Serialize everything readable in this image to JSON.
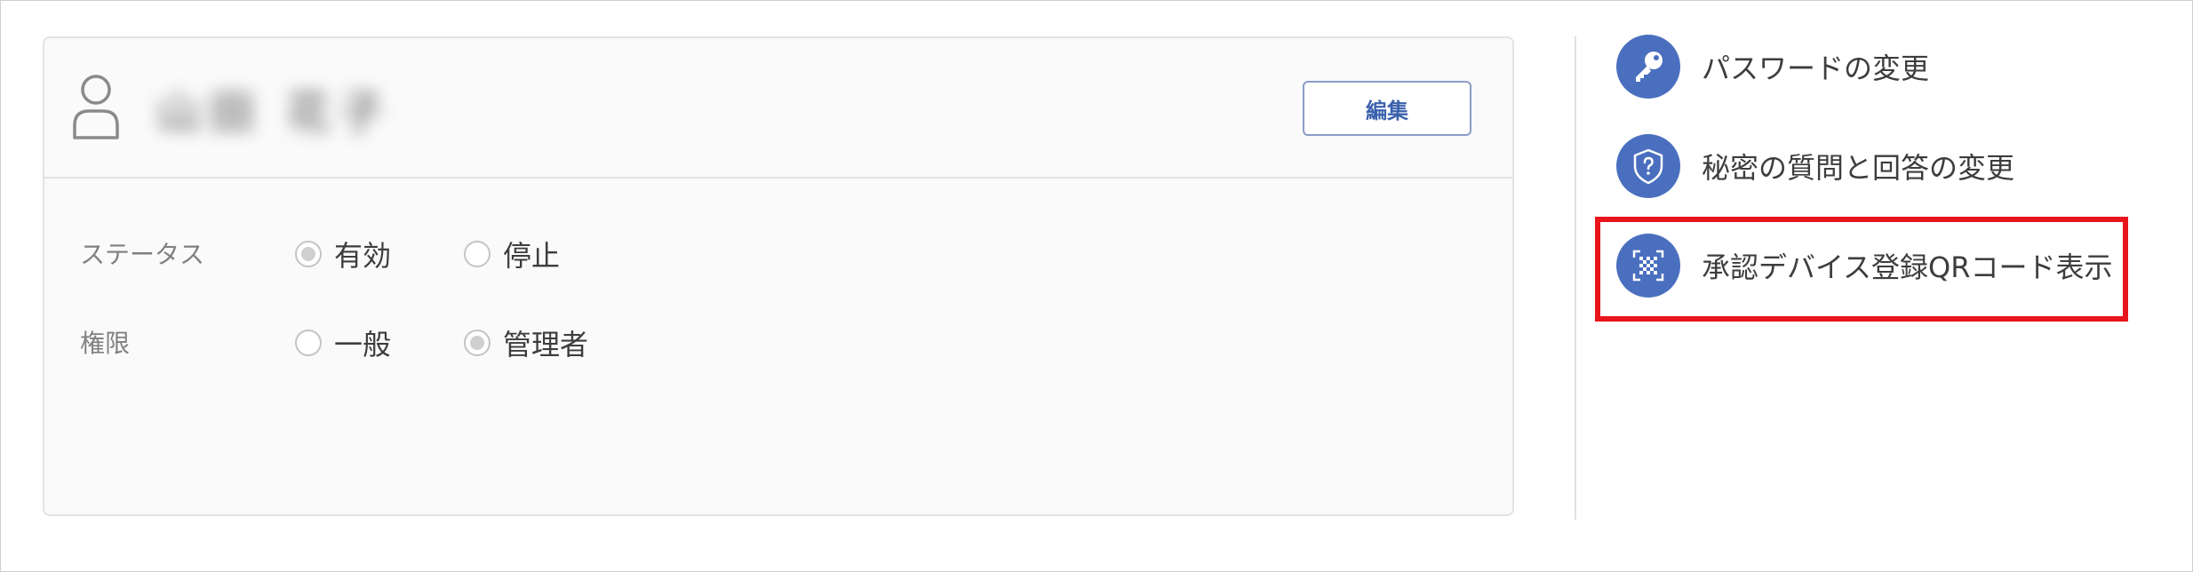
{
  "user": {
    "name": "山田 花子",
    "edit_label": "編集"
  },
  "status": {
    "label": "ステータス",
    "options": [
      {
        "label": "有効",
        "checked": true
      },
      {
        "label": "停止",
        "checked": false
      }
    ]
  },
  "permission": {
    "label": "権限",
    "options": [
      {
        "label": "一般",
        "checked": false
      },
      {
        "label": "管理者",
        "checked": true
      }
    ]
  },
  "menu": {
    "items": [
      {
        "label": "パスワードの変更",
        "icon": "key-icon"
      },
      {
        "label": "秘密の質問と回答の変更",
        "icon": "shield-question-icon"
      },
      {
        "label": "承認デバイス登録QRコード表示",
        "icon": "qr-code-icon"
      }
    ]
  },
  "colors": {
    "accent": "#4a6fbf",
    "button_text": "#3b62ad",
    "highlight": "#e8141b"
  }
}
